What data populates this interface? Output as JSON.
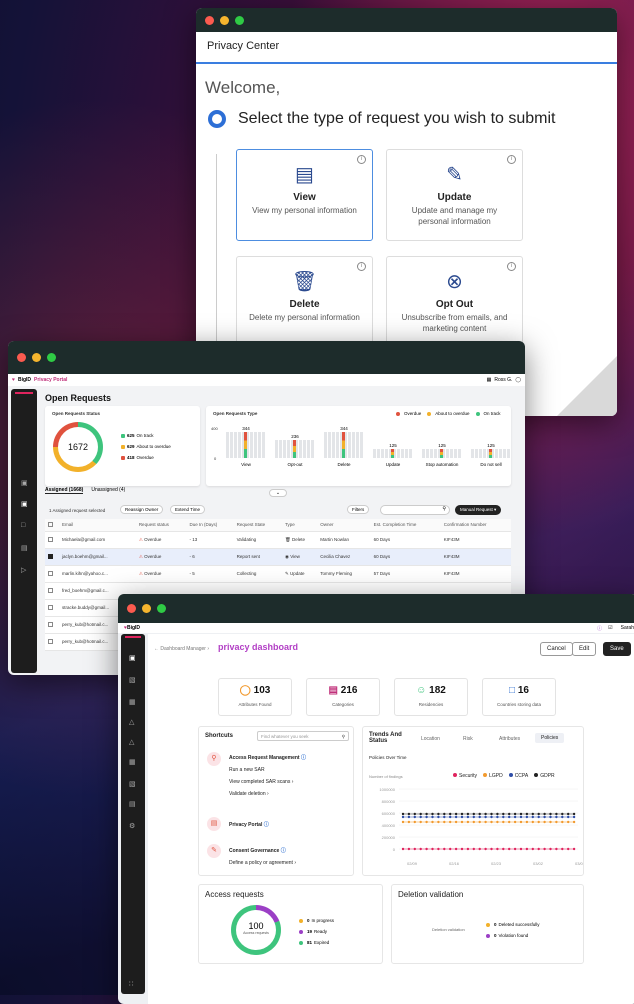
{
  "privacy_center": {
    "title": "Privacy Center",
    "welcome": "Welcome,",
    "prompt": "Select the type of request you wish to submit",
    "cards": [
      {
        "title": "View",
        "desc": "View my personal information",
        "icon": "document-icon"
      },
      {
        "title": "Update",
        "desc": "Update and manage my personal information",
        "icon": "edit-icon"
      },
      {
        "title": "Delete",
        "desc": "Delete my personal information",
        "icon": "trash-icon"
      },
      {
        "title": "Opt Out",
        "desc": "Unsubscribe from emails, and marketing content",
        "icon": "close-circle-icon"
      }
    ]
  },
  "requests": {
    "brand": "BigID",
    "product": "Privacy Portal",
    "user": "Ross G.",
    "page_title": "Open Requests",
    "status_title": "Open Requests Status",
    "total": "1672",
    "status_legend": [
      {
        "value": "625",
        "label": "On track",
        "color": "#3ec47d"
      },
      {
        "value": "629",
        "label": "About to overdue",
        "color": "#f2b12a"
      },
      {
        "value": "418",
        "label": "Overdue",
        "color": "#e0523e"
      }
    ],
    "type_title": "Open Requests Type",
    "type_legend": [
      "Overdue",
      "About to overdue",
      "On track"
    ],
    "type_axis": [
      "400",
      "0"
    ],
    "types": [
      {
        "label": "View",
        "value": "344"
      },
      {
        "label": "Opt-out",
        "value": "236"
      },
      {
        "label": "Delete",
        "value": "344"
      },
      {
        "label": "Update",
        "value": "125"
      },
      {
        "label": "Stop automation",
        "value": "125"
      },
      {
        "label": "Do not sell",
        "value": "125"
      }
    ],
    "tabs": [
      "Assigned (1668)",
      "Unassigned (4)"
    ],
    "selected_note": "1 Assigned request selected",
    "reassign": "Reassign Owner",
    "extend": "Extend Time",
    "filters": "Filters",
    "manual": "Manual Request",
    "columns": [
      "Email",
      "Request status",
      "Due In (Days)",
      "Request State",
      "Type",
      "Owner",
      "Est. Completion Time",
      "Confirmation Number"
    ],
    "rows": [
      [
        "Michaela@gmail.com",
        "Overdue",
        "- 13",
        "Validating",
        "Delete",
        "Martin Nowlan",
        "60 Days",
        "KIF43M"
      ],
      [
        "jaclyn.boehm@gmail...",
        "Overdue",
        "- 6",
        "Report sent",
        "View",
        "Cecilia Chavez",
        "60 Days",
        "KIF43M"
      ],
      [
        "marlin.kihn@yahoo.c...",
        "Overdue",
        "- 5",
        "Collecting",
        "Update",
        "Tommy Fleming",
        "57 Days",
        "KIF43M"
      ],
      [
        "fred_boehm@gmail.c...",
        "",
        "",
        "",
        "",
        "",
        "",
        ""
      ],
      [
        "stracke.buddy@gmail...",
        "",
        "",
        "",
        "",
        "",
        "",
        ""
      ],
      [
        "perry_kub@hotmail.c...",
        "",
        "",
        "",
        "",
        "",
        "",
        ""
      ],
      [
        "perry_kub@hotmail.c...",
        "",
        "",
        "",
        "",
        "",
        "",
        ""
      ]
    ]
  },
  "dashboard": {
    "brand": "BigID",
    "user": "Sarah",
    "breadcrumb": "Dashboard Manager",
    "title": "privacy dashboard",
    "buttons": [
      "Cancel",
      "Edit",
      "Save"
    ],
    "stats": [
      {
        "value": "103",
        "label": "Attributes Found"
      },
      {
        "value": "216",
        "label": "Categories"
      },
      {
        "value": "182",
        "label": "Residencies"
      },
      {
        "value": "16",
        "label": "Countries storing data"
      }
    ],
    "shortcuts_title": "Shortcuts",
    "search_placeholder": "Find whatever you seek",
    "arm": "Access Request Management",
    "arm_links": [
      "Run a new SAR",
      "View completed SAR scans",
      "Validate deletion"
    ],
    "portal": "Privacy Portal",
    "consent": "Consent Governance",
    "consent_link": "Define a policy or agreement",
    "trends_title": "Trends And Status",
    "trend_tabs": [
      "Location",
      "Risk",
      "Attributes",
      "Policies"
    ],
    "policies_over_time": "Policies Over Time",
    "findings": "Number of findings",
    "legend": [
      {
        "name": "Security",
        "color": "#e0245e"
      },
      {
        "name": "LGPD",
        "color": "#f29a2e"
      },
      {
        "name": "CCPA",
        "color": "#2f4ea8"
      },
      {
        "name": "GDPR",
        "color": "#222222"
      }
    ],
    "yticks": [
      "1000000",
      "800000",
      "600000",
      "400000",
      "200000",
      "0"
    ],
    "xticks": [
      "02/09",
      "02/16",
      "02/23",
      "03/02",
      "03/09"
    ],
    "access_title": "Access requests",
    "access_total": "100",
    "access_sub": "Access requests",
    "access_legend": [
      {
        "value": "0",
        "label": "In progress",
        "color": "#f2b12a"
      },
      {
        "value": "19",
        "label": "Ready",
        "color": "#9b3fc5"
      },
      {
        "value": "81",
        "label": "Expired",
        "color": "#3ec47d"
      }
    ],
    "deletion_title": "Deletion validation",
    "deletion_label": "Deletion validation",
    "deletion_legend": [
      {
        "value": "0",
        "label": "Deleted successfully",
        "color": "#f2b12a"
      },
      {
        "value": "0",
        "label": "Violation found",
        "color": "#9b3fc5"
      }
    ]
  }
}
